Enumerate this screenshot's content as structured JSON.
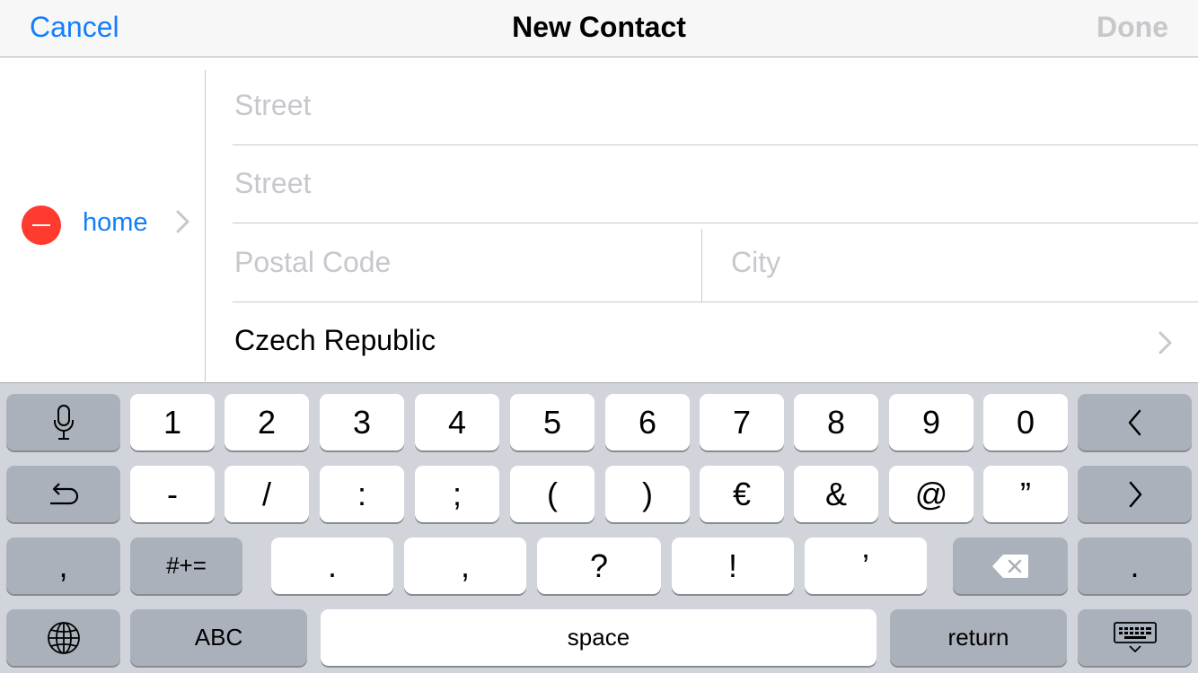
{
  "navbar": {
    "cancel_label": "Cancel",
    "title": "New Contact",
    "done_label": "Done"
  },
  "address": {
    "label": "home",
    "street1_placeholder": "Street",
    "street2_placeholder": "Street",
    "postal_placeholder": "Postal Code",
    "city_placeholder": "City",
    "country": "Czech Republic"
  },
  "keyboard": {
    "row1": [
      "1",
      "2",
      "3",
      "4",
      "5",
      "6",
      "7",
      "8",
      "9",
      "0"
    ],
    "row2": [
      "-",
      "/",
      ":",
      ";",
      "(",
      ")",
      "€",
      "&",
      "@",
      "”"
    ],
    "row3": [
      ".",
      ",",
      "?",
      "!",
      "’"
    ],
    "left_comma": ",",
    "right_period": ".",
    "symbols_label": "#+=",
    "abc_label": "ABC",
    "space_label": "space",
    "return_label": "return",
    "icons": {
      "mic": "microphone-icon",
      "undo": "undo-icon",
      "left": "cursor-left-icon",
      "right": "cursor-right-icon",
      "delete": "delete-backspace-icon",
      "globe": "globe-icon",
      "dismiss": "keyboard-dismiss-icon"
    }
  },
  "colors": {
    "accent": "#147efb",
    "delete_red": "#ff3b30",
    "placeholder": "#c7c7cd",
    "keyboard_bg": "#d1d5db",
    "key_dark": "#abb1bb"
  }
}
